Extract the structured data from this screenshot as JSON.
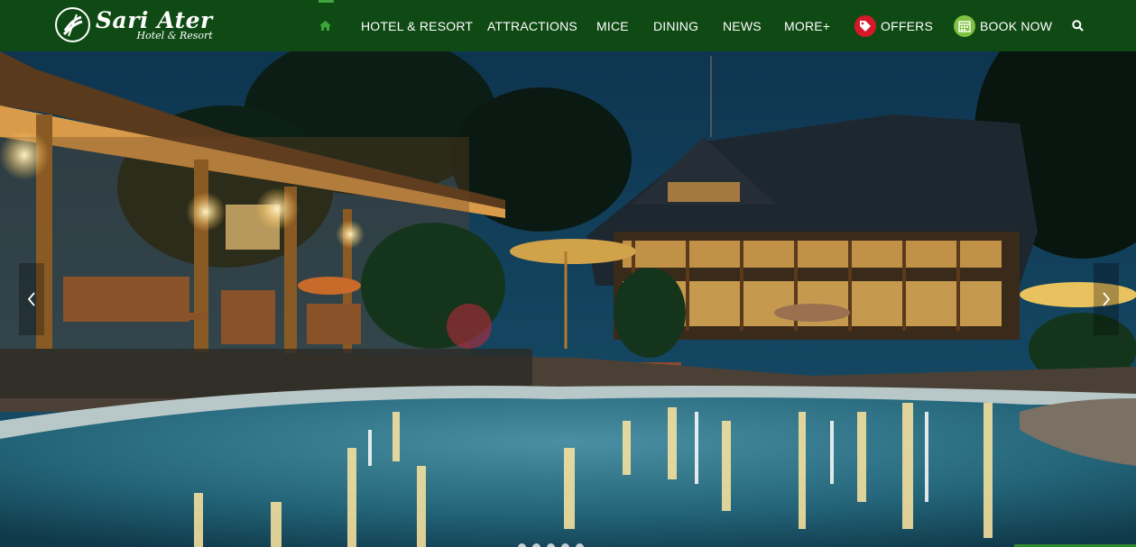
{
  "brand": {
    "name": "Sari Ater",
    "tagline": "Hotel & Resort"
  },
  "nav": {
    "home_icon": "home-icon",
    "items": [
      {
        "label": "HOTEL & RESORT"
      },
      {
        "label": "ATTRACTIONS"
      },
      {
        "label": "MICE"
      },
      {
        "label": "DINING"
      },
      {
        "label": "NEWS"
      },
      {
        "label": "MORE+"
      }
    ],
    "offers": {
      "label": "OFFERS",
      "icon": "tag-icon",
      "color": "#d7182a"
    },
    "book_now": {
      "label": "BOOK NOW",
      "icon": "calendar-icon",
      "color": "#7fc242"
    },
    "search_icon": "search-icon"
  },
  "slider": {
    "prev_icon": "chevron-left-icon",
    "next_icon": "chevron-right-icon",
    "slide_count": 5,
    "active_slide": 1
  },
  "colors": {
    "header_bg": "#0f4a14",
    "accent_green": "#3ea63c"
  }
}
